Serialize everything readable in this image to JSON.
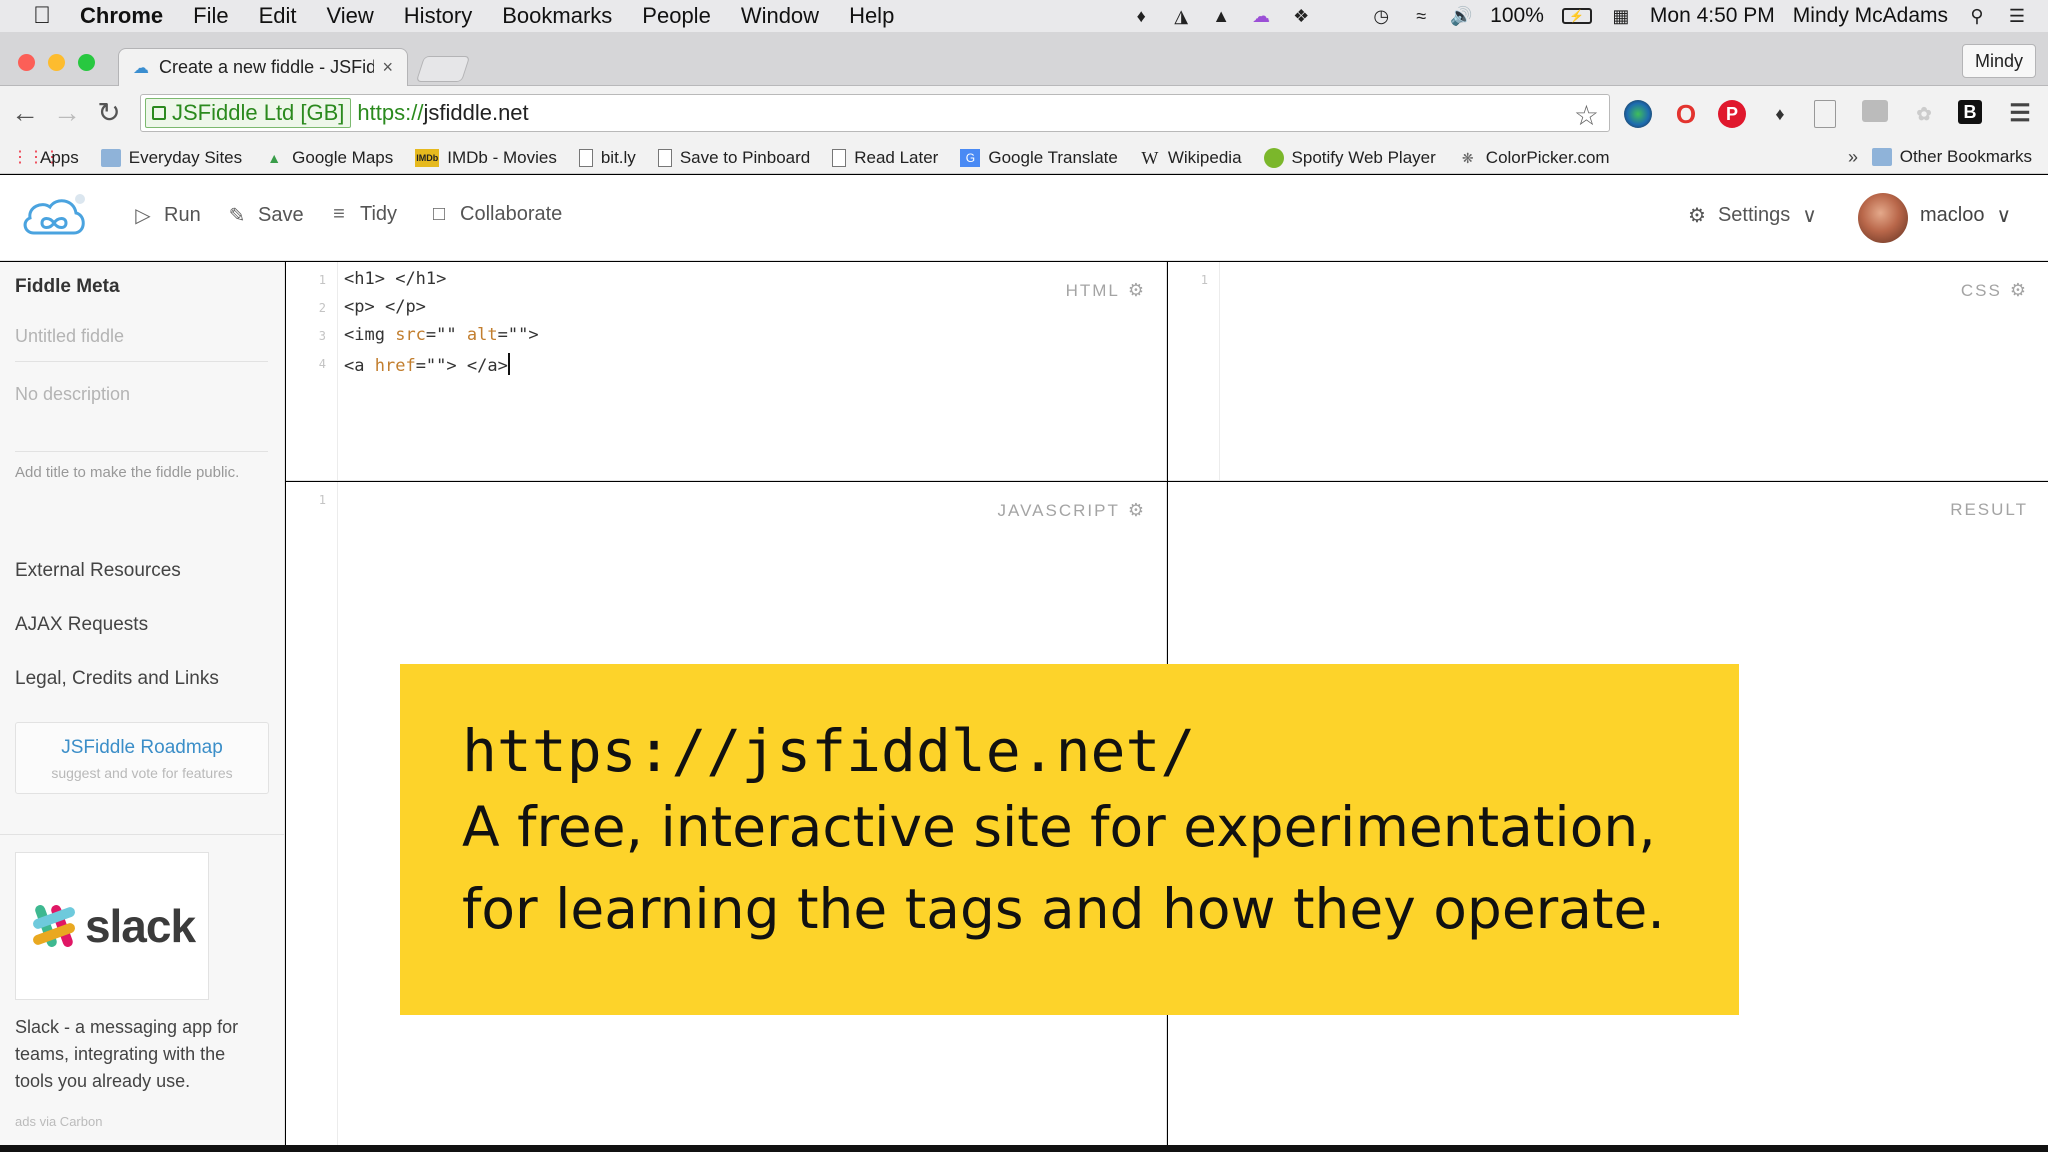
{
  "menubar": {
    "app": "Chrome",
    "items": [
      "File",
      "Edit",
      "View",
      "History",
      "Bookmarks",
      "People",
      "Window",
      "Help"
    ],
    "battery": "100%",
    "clock": "Mon 4:50 PM",
    "user": "Mindy McAdams"
  },
  "browser": {
    "tab_title": "Create a new fiddle - JSFid",
    "profile": "Mindy",
    "ev_label": "JSFiddle Ltd [GB]",
    "url_scheme": "https://",
    "url_host": "jsfiddle.net"
  },
  "bookmarks": {
    "items": [
      "Apps",
      "Everyday Sites",
      "Google Maps",
      "IMDb - Movies",
      "bit.ly",
      "Save to Pinboard",
      "Read Later",
      "Google Translate",
      "Wikipedia",
      "Spotify Web Player",
      "ColorPicker.com"
    ],
    "overflow": "»",
    "other": "Other Bookmarks"
  },
  "jsfiddle": {
    "actions": {
      "run": "Run",
      "save": "Save",
      "tidy": "Tidy",
      "collaborate": "Collaborate"
    },
    "settings": "Settings",
    "username": "macloo"
  },
  "sidebar": {
    "title": "Fiddle Meta",
    "title_placeholder": "Untitled fiddle",
    "description_placeholder": "No description",
    "note": "Add title to make the fiddle public.",
    "links": [
      "External Resources",
      "AJAX Requests",
      "Legal, Credits and Links"
    ],
    "roadmap_title": "JSFiddle Roadmap",
    "roadmap_sub": "suggest and vote for features",
    "ad_brand": "slack",
    "ad_text": "Slack - a messaging app for teams, integrating with the tools you already use.",
    "ad_via": "ads via Carbon"
  },
  "panels": {
    "html_label": "HTML",
    "css_label": "CSS",
    "js_label": "JAVASCRIPT",
    "result_label": "RESULT",
    "html_line_numbers": [
      "1",
      "2",
      "3",
      "4"
    ],
    "css_line_numbers": [
      "1"
    ],
    "js_line_numbers": [
      "1"
    ]
  },
  "caption": {
    "url": "https://jsfiddle.net/",
    "line1": "A free, interactive site for experimentation,",
    "line2": "for learning the tags and how they operate."
  },
  "colors": {
    "caption_bg": "#fdd32a",
    "ev_green": "#2b8a1e",
    "link_blue": "#3b8ec8"
  }
}
